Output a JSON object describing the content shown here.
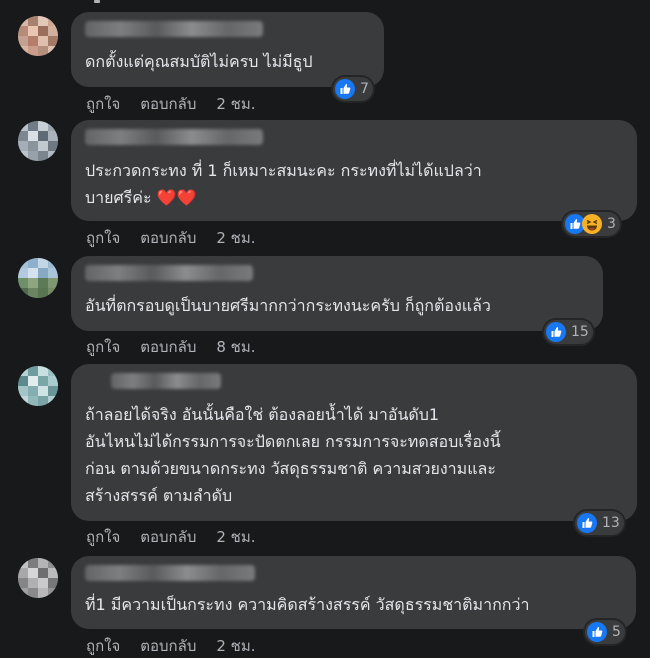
{
  "actions": {
    "like": "ถูกใจ",
    "reply": "ตอบกลับ"
  },
  "comments": [
    {
      "text": "ดกตั้งแต่คุณสมบัติไม่ครบ ไม่มีธูป",
      "reaction_count": "7",
      "time": "2 ชม."
    },
    {
      "text": "ประกวดกระทง ที่ 1 ก็เหมาะสมนะคะ กระทงที่ไม่ได้แปลว่า\nบายศรีค่ะ ❤️❤️",
      "reaction_count": "3",
      "time": "2 ชม."
    },
    {
      "text": "อันที่ตกรอบดูเป็นบายศรีมากกว่ากระทงนะครับ ก็ถูกต้องแล้ว",
      "reaction_count": "15",
      "time": "8 ชม."
    },
    {
      "text": "ถ้าลอยได้จริง อันนั้นคือใช่ ต้องลอยน้ำได้ มาอันดับ1\nอันไหนไม่ได้กรรมการจะปัดตกเลย กรรมการจะทดสอบเรื่องนี้\nก่อน ตามด้วยขนาดกระทง วัสดุธรรมชาติ ความสวยงามและ\nสร้างสรรค์ ตามลำดับ",
      "reaction_count": "13",
      "time": "2 ชม."
    },
    {
      "text": "ที่1 มีความเป็นกระทง ความคิดสร้างสรรค์ วัสดุธรรมชาติมากกว่า",
      "reaction_count": "5",
      "time": "2 ชม."
    }
  ],
  "colors": {
    "background": "#18191a",
    "bubble": "#3a3b3c",
    "like_blue": "#1877f2",
    "secondary_text": "#b0b3b8"
  },
  "icons": [
    "like-icon",
    "haha-icon"
  ]
}
